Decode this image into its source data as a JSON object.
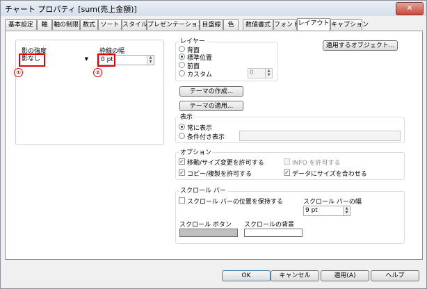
{
  "window": {
    "title": "チャート プロパティ [sum(売上金額)]",
    "close_glyph": "✕"
  },
  "tabs": [
    "基本設定",
    "軸",
    "軸の制限",
    "数式",
    "ソート",
    "スタイル",
    "プレゼンテーション",
    "目盛線",
    "色",
    "数値書式",
    "フォント",
    "レイアウト",
    "キャプション"
  ],
  "active_tab": "レイアウト",
  "shadow": {
    "label": "影の強度",
    "value": "影なし",
    "marker": "①"
  },
  "border": {
    "label": "枠線の幅",
    "value": "0 pt",
    "marker": "②"
  },
  "layer": {
    "label": "レイヤー",
    "options": [
      "背面",
      "標準位置",
      "前面",
      "カスタム"
    ],
    "selected": "標準位置",
    "custom_value": "0"
  },
  "buttons": {
    "apply_objects": "適用するオブジェクト...",
    "create_theme": "テーマの作成...",
    "apply_theme": "テーマの適用..."
  },
  "display": {
    "label": "表示",
    "options": [
      "常に表示",
      "条件付き表示"
    ],
    "selected": "常に表示"
  },
  "options": {
    "label": "オプション",
    "allow_move_resize": {
      "label": "移動/サイズ変更を許可する",
      "checked": true
    },
    "allow_info": {
      "label": "INFO を許可する",
      "checked": false
    },
    "allow_copy": {
      "label": "コピー/複製を許可する",
      "checked": true
    },
    "fit_data": {
      "label": "データにサイズを合わせる",
      "checked": true
    }
  },
  "scrollbar": {
    "label": "スクロール バー",
    "keep_position": {
      "label": "スクロール バーの位置を保持する",
      "checked": false
    },
    "width_label": "スクロール バーの幅",
    "width_value": "9 pt",
    "button_label": "スクロール ボタン",
    "background_label": "スクロールの背景"
  },
  "footer": {
    "ok": "OK",
    "cancel": "キャンセル",
    "apply": "適用(A)",
    "help": "ヘルプ"
  },
  "colors": {
    "annotation": "#e00000",
    "scroll_button_swatch": "#c0c0c0",
    "scroll_bg_swatch": "#ffffff"
  }
}
